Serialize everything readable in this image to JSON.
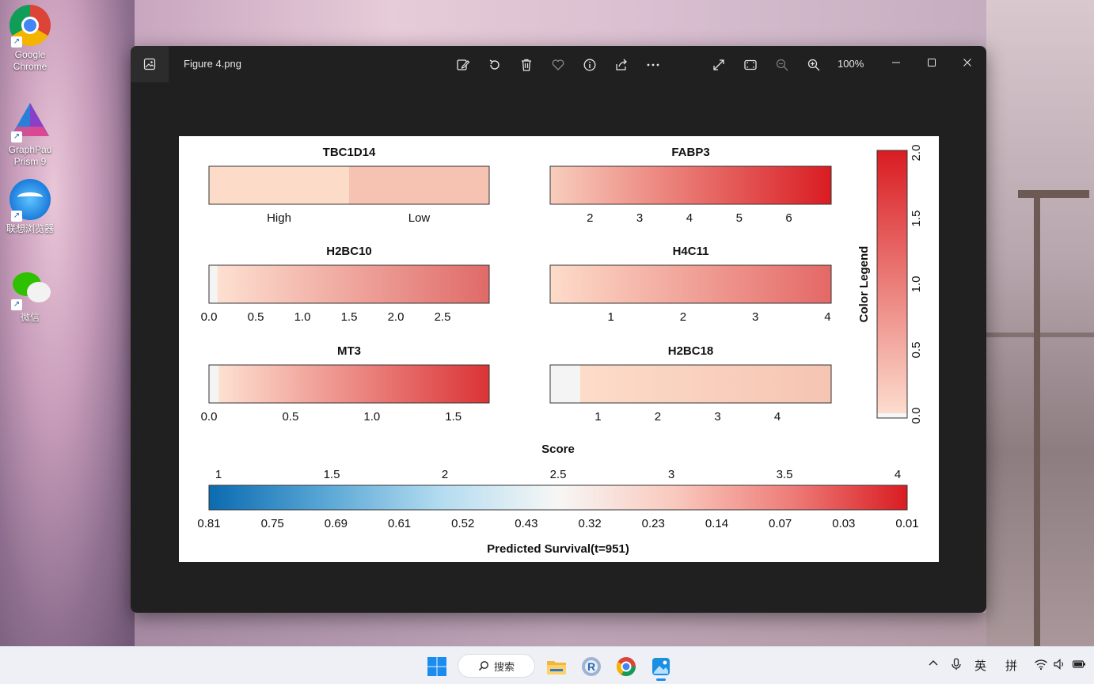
{
  "desktop": {
    "icons": [
      {
        "id": "chrome",
        "label": "Google\nChrome",
        "icon": "chrome-icon"
      },
      {
        "id": "prism",
        "label": "GraphPad\nPrism 9",
        "icon": "prism-icon"
      },
      {
        "id": "browser",
        "label": "联想浏览器",
        "icon": "browser-icon"
      },
      {
        "id": "wechat",
        "label": "微信",
        "icon": "wechat-icon"
      }
    ]
  },
  "viewer": {
    "file_name": "Figure 4.png",
    "zoom": "100%",
    "toolbar_icons": [
      "edit-icon",
      "rotate-icon",
      "delete-icon",
      "favorite-icon",
      "info-icon",
      "share-icon",
      "more-icon",
      "fullscreen-icon",
      "fit-icon",
      "zoom-out-icon",
      "zoom-in-icon"
    ],
    "window_controls": [
      "minimize-icon",
      "maximize-icon",
      "close-icon"
    ]
  },
  "chart_data": {
    "type": "heatmap",
    "panels": [
      {
        "title": "TBC1D14",
        "kind": "categorical",
        "categories": [
          "High",
          "Low"
        ],
        "colors": [
          "#fcdcc9",
          "#f6c2b1"
        ]
      },
      {
        "title": "FABP3",
        "kind": "continuous",
        "range": [
          1.2,
          6.85
        ],
        "ticks": [
          "2",
          "3",
          "4",
          "5",
          "6"
        ],
        "tick_values": [
          2,
          3,
          4,
          5,
          6
        ],
        "color_from": "#f8cdbd",
        "color_to": "#d91c22"
      },
      {
        "title": "H2BC10",
        "kind": "continuous",
        "range": [
          0.0,
          3.0
        ],
        "ticks": [
          "0.0",
          "0.5",
          "1.0",
          "1.5",
          "2.0",
          "2.5"
        ],
        "tick_values": [
          0.0,
          0.5,
          1.0,
          1.5,
          2.0,
          2.5
        ],
        "zero_band": 0.09,
        "color_from": "#fde0d1",
        "color_to": "#e06a68"
      },
      {
        "title": "H4C11",
        "kind": "continuous",
        "range": [
          0.16,
          4.05
        ],
        "ticks": [
          "1",
          "2",
          "3",
          "4"
        ],
        "tick_values": [
          1,
          2,
          3,
          4
        ],
        "color_from": "#fddcca",
        "color_to": "#e46866"
      },
      {
        "title": "MT3",
        "kind": "continuous",
        "range": [
          0.0,
          1.72
        ],
        "ticks": [
          "0.0",
          "0.5",
          "1.0",
          "1.5"
        ],
        "tick_values": [
          0.0,
          0.5,
          1.0,
          1.5
        ],
        "zero_band": 0.06,
        "color_from": "#fde0d1",
        "color_to": "#db3336"
      },
      {
        "title": "H2BC18",
        "kind": "continuous",
        "range": [
          0.2,
          4.9
        ],
        "ticks": [
          "1",
          "2",
          "3",
          "4"
        ],
        "tick_values": [
          1,
          2,
          3,
          4
        ],
        "zero_band": 0.5,
        "color_from": "#fcdcc9",
        "color_to": "#f6c4b2"
      }
    ],
    "legend": {
      "title": "Color Legend",
      "ticks": [
        "0.0",
        "0.5",
        "1.0",
        "1.5",
        "2.0"
      ],
      "tick_values": [
        0.0,
        0.5,
        1.0,
        1.5,
        2.0
      ],
      "range": [
        0.0,
        2.0
      ],
      "color_from": "#fde0d1",
      "color_to": "#d91c22"
    },
    "score": {
      "title": "Score",
      "score_ticks": [
        "1",
        "1.5",
        "2",
        "2.5",
        "3",
        "3.5",
        "4"
      ],
      "score_values": [
        1,
        1.5,
        2,
        2.5,
        3,
        3.5,
        4
      ],
      "survival_ticks": [
        "0.81",
        "0.75",
        "0.69",
        "0.61",
        "0.52",
        "0.43",
        "0.32",
        "0.23",
        "0.14",
        "0.07",
        "0.03",
        "0.01"
      ],
      "xlabel": "Predicted Survival(t=951)",
      "colors": [
        "#0a6bb0",
        "#5aa7d6",
        "#b4dcf0",
        "#f7f7f5",
        "#f9c9bd",
        "#ee7d79",
        "#d91c22"
      ]
    }
  },
  "taskbar": {
    "search_label": "搜索",
    "ime_lang": "英",
    "ime_mode": "拼",
    "apps": [
      "start-icon",
      "file-explorer-icon",
      "r-icon",
      "chrome-icon",
      "photos-icon"
    ],
    "tray_icons": [
      "chevron-up-icon",
      "microphone-icon",
      "wifi-icon",
      "volume-icon",
      "battery-icon"
    ]
  }
}
